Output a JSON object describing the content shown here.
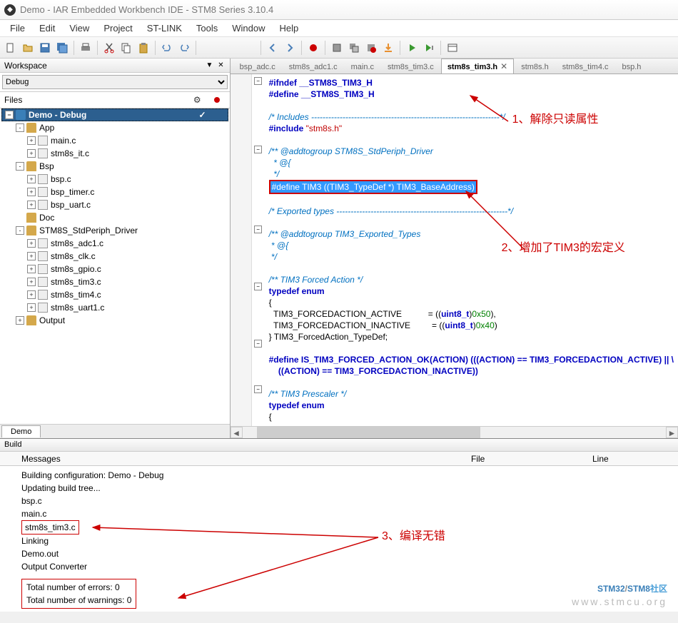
{
  "window": {
    "title": "Demo - IAR Embedded Workbench IDE - STM8 Series 3.10.4"
  },
  "menu": [
    "File",
    "Edit",
    "View",
    "Project",
    "ST-LINK",
    "Tools",
    "Window",
    "Help"
  ],
  "workspace": {
    "title": "Workspace",
    "config": "Debug",
    "files_label": "Files",
    "root": "Demo - Debug",
    "tree": [
      {
        "l": 1,
        "t": "-",
        "i": "folder",
        "n": "App"
      },
      {
        "l": 2,
        "t": "+",
        "i": "file",
        "n": "main.c"
      },
      {
        "l": 2,
        "t": "+",
        "i": "file",
        "n": "stm8s_it.c"
      },
      {
        "l": 1,
        "t": "-",
        "i": "folder",
        "n": "Bsp"
      },
      {
        "l": 2,
        "t": "+",
        "i": "file",
        "n": "bsp.c"
      },
      {
        "l": 2,
        "t": "+",
        "i": "file",
        "n": "bsp_timer.c"
      },
      {
        "l": 2,
        "t": "+",
        "i": "file",
        "n": "bsp_uart.c"
      },
      {
        "l": 1,
        "t": " ",
        "i": "folder",
        "n": "Doc"
      },
      {
        "l": 1,
        "t": "-",
        "i": "folder",
        "n": "STM8S_StdPeriph_Driver"
      },
      {
        "l": 2,
        "t": "+",
        "i": "file",
        "n": "stm8s_adc1.c"
      },
      {
        "l": 2,
        "t": "+",
        "i": "file",
        "n": "stm8s_clk.c"
      },
      {
        "l": 2,
        "t": "+",
        "i": "file",
        "n": "stm8s_gpio.c"
      },
      {
        "l": 2,
        "t": "+",
        "i": "file",
        "n": "stm8s_tim3.c"
      },
      {
        "l": 2,
        "t": "+",
        "i": "file",
        "n": "stm8s_tim4.c"
      },
      {
        "l": 2,
        "t": "+",
        "i": "file",
        "n": "stm8s_uart1.c"
      },
      {
        "l": 1,
        "t": "+",
        "i": "folder",
        "n": "Output"
      }
    ],
    "tab": "Demo"
  },
  "tabs": [
    "bsp_adc.c",
    "stm8s_adc1.c",
    "main.c",
    "stm8s_tim3.c",
    "stm8s_tim3.h",
    "stm8s.h",
    "stm8s_tim4.c",
    "bsp.h"
  ],
  "active_tab": 4,
  "annotations": {
    "a1": "1、解除只读属性",
    "a2": "2、增加了TIM3的宏定义",
    "a3": "3、编译无错"
  },
  "code": {
    "l1": "#ifndef __STM8S_TIM3_H",
    "l2": "#define __STM8S_TIM3_H",
    "l3": "/* Includes ------------------------------------------------------------------*/",
    "l4a": "#include ",
    "l4b": "\"stm8s.h\"",
    "l5": "/** @addtogroup STM8S_StdPeriph_Driver",
    "l6": "  * @{",
    "l7": "  */",
    "l8": "#define TIM3 ((TIM3_TypeDef *) TIM3_BaseAddress)",
    "l9": "/* Exported types ------------------------------------------------------------*/",
    "l10": "/** @addtogroup TIM3_Exported_Types",
    "l11": " * @{",
    "l12": " */",
    "l13": "/** TIM3 Forced Action */",
    "l14a": "typedef",
    "l14b": " enum",
    "l15": "{",
    "l16a": "  TIM3_FORCEDACTION_ACTIVE           = ((",
    "l16b": "uint8_t",
    "l16c": ")",
    "l16d": "0x50",
    "l16e": "),",
    "l17a": "  TIM3_FORCEDACTION_INACTIVE         = ((",
    "l17b": "uint8_t",
    "l17c": ")",
    "l17d": "0x40",
    "l17e": ")",
    "l18": "} TIM3_ForcedAction_TypeDef;",
    "l19": "#define IS_TIM3_FORCED_ACTION_OK(ACTION) (((ACTION) == TIM3_FORCEDACTION_ACTIVE) || \\",
    "l20": "    ((ACTION) == TIM3_FORCEDACTION_INACTIVE))",
    "l21": "/** TIM3 Prescaler */",
    "l22a": "typedef",
    "l22b": " enum",
    "l23": "{"
  },
  "build": {
    "title": "Build",
    "cols": {
      "c1": "Messages",
      "c2": "File",
      "c3": "Line"
    },
    "msgs": [
      "Building configuration: Demo - Debug",
      "Updating build tree...",
      "bsp.c",
      "main.c",
      "stm8s_tim3.c",
      "Linking",
      "Demo.out",
      "Output Converter"
    ],
    "summary": [
      "Total number of errors: 0",
      "Total number of warnings: 0"
    ]
  },
  "watermark": {
    "a": "STM32",
    "b": "/",
    "c": "STM8",
    "d": "社区",
    "url": "www.stmcu.org"
  }
}
